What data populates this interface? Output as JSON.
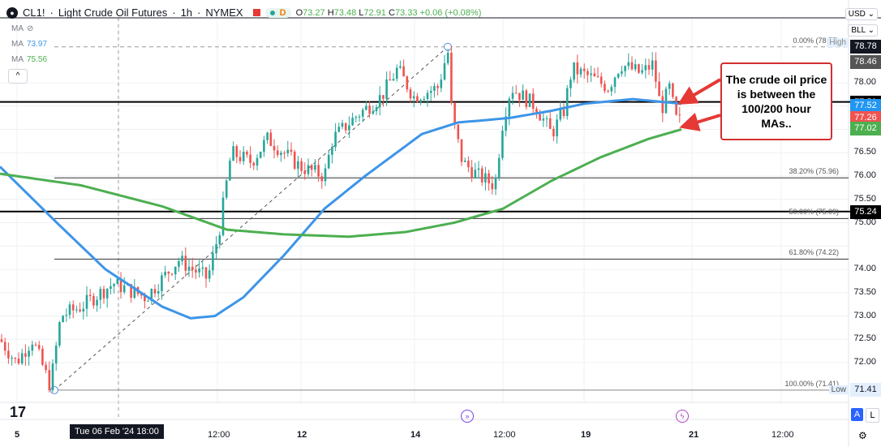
{
  "header": {
    "symbol": "CL1!",
    "title": "Light Crude Oil Futures",
    "interval": "1h",
    "exchange": "NYMEX",
    "d_badge": "D",
    "open_label": "O",
    "open": "73.27",
    "high_label": "H",
    "high": "73.48",
    "low_label": "L",
    "low": "72.91",
    "close_label": "C",
    "close": "73.33",
    "change": "+0.06 (+0.08%)"
  },
  "indicators": [
    {
      "label": "MA",
      "value": ""
    },
    {
      "label": "MA",
      "value": "73.97"
    },
    {
      "label": "MA",
      "value": "75.56"
    }
  ],
  "collapse_label": "^",
  "currency": "USD ⌄",
  "unit": "BLL ⌄",
  "price_labels": [
    {
      "text": "78.78",
      "price": 78.78,
      "color": "#131722"
    },
    {
      "text": "78.46",
      "price": 78.46,
      "color": "#555555"
    },
    {
      "text": "77.59",
      "price": 77.59,
      "color": "#000000"
    },
    {
      "text": "77.52",
      "price": 77.52,
      "color": "#2196f3"
    },
    {
      "text": "77.26",
      "price": 77.26,
      "color": "#ef5350"
    },
    {
      "text": "77.02",
      "price": 77.02,
      "color": "#4caf50"
    },
    {
      "text": "75.24",
      "price": 75.24,
      "color": "#000000"
    }
  ],
  "low_label_text": "71.41",
  "price_ticks": [
    "78.00",
    "76.50",
    "76.00",
    "75.50",
    "75.00",
    "74.00",
    "73.50",
    "73.00",
    "72.50",
    "72.00"
  ],
  "fib": [
    {
      "text": "0.00% (78.77)",
      "price": 78.77
    },
    {
      "text": "38.20% (75.96)",
      "price": 75.96
    },
    {
      "text": "50.00% (75.09)",
      "price": 75.09
    },
    {
      "text": "61.80% (74.22)",
      "price": 74.22
    },
    {
      "text": "100.00% (71.41)",
      "price": 71.41
    }
  ],
  "high_tag": "High",
  "low_tag": "Low",
  "x_labels": [
    "5",
    "12:00",
    "12",
    "14",
    "12:00",
    "19",
    "21",
    "12:00"
  ],
  "crosshair_label": "Tue 06 Feb '24  18:00",
  "callout": "The crude oil price is between the 100/200 hour MAs..",
  "scale_buttons": [
    "A",
    "L"
  ],
  "chart_data": {
    "type": "candlestick",
    "ylim": [
      71.2,
      79.1
    ],
    "horizontal_lines": [
      77.59,
      75.24
    ],
    "price_path": [
      [
        0,
        72.5
      ],
      [
        20,
        72.0
      ],
      [
        40,
        72.5
      ],
      [
        62,
        71.5
      ],
      [
        75,
        73.0
      ],
      [
        100,
        73.2
      ],
      [
        140,
        73.7
      ],
      [
        180,
        73.4
      ],
      [
        220,
        74.2
      ],
      [
        256,
        73.8
      ],
      [
        270,
        74.8
      ],
      [
        285,
        76.5
      ],
      [
        310,
        76.3
      ],
      [
        330,
        76.8
      ],
      [
        370,
        76.2
      ],
      [
        400,
        76.0
      ],
      [
        410,
        76.8
      ],
      [
        440,
        77.3
      ],
      [
        470,
        77.7
      ],
      [
        490,
        78.3
      ],
      [
        510,
        77.7
      ],
      [
        540,
        77.9
      ],
      [
        552,
        78.7
      ],
      [
        557,
        77.3
      ],
      [
        570,
        76.3
      ],
      [
        590,
        76.0
      ],
      [
        610,
        75.8
      ],
      [
        620,
        77.2
      ],
      [
        630,
        77.9
      ],
      [
        660,
        77.5
      ],
      [
        680,
        76.9
      ],
      [
        695,
        77.4
      ],
      [
        705,
        78.3
      ],
      [
        730,
        78.1
      ],
      [
        750,
        77.9
      ],
      [
        765,
        78.4
      ],
      [
        790,
        78.2
      ],
      [
        805,
        78.4
      ],
      [
        815,
        77.4
      ],
      [
        825,
        77.9
      ],
      [
        835,
        77.1
      ],
      [
        842,
        77.3
      ]
    ],
    "series": [
      {
        "name": "MA 100",
        "color": "#3d95e8",
        "points": [
          [
            0,
            76.2
          ],
          [
            70,
            75.0
          ],
          [
            130,
            74.0
          ],
          [
            200,
            73.2
          ],
          [
            235,
            72.95
          ],
          [
            265,
            73.0
          ],
          [
            300,
            73.4
          ],
          [
            350,
            74.3
          ],
          [
            400,
            75.3
          ],
          [
            450,
            76.0
          ],
          [
            520,
            76.9
          ],
          [
            565,
            77.15
          ],
          [
            600,
            77.2
          ],
          [
            630,
            77.25
          ],
          [
            680,
            77.4
          ],
          [
            720,
            77.55
          ],
          [
            780,
            77.65
          ],
          [
            840,
            77.55
          ]
        ]
      },
      {
        "name": "MA 200",
        "color": "#4caf50",
        "points": [
          [
            0,
            76.05
          ],
          [
            100,
            75.8
          ],
          [
            200,
            75.35
          ],
          [
            280,
            74.85
          ],
          [
            350,
            74.75
          ],
          [
            430,
            74.7
          ],
          [
            500,
            74.8
          ],
          [
            560,
            75.0
          ],
          [
            620,
            75.3
          ],
          [
            680,
            75.9
          ],
          [
            740,
            76.4
          ],
          [
            800,
            76.8
          ],
          [
            840,
            77.0
          ]
        ]
      }
    ]
  }
}
